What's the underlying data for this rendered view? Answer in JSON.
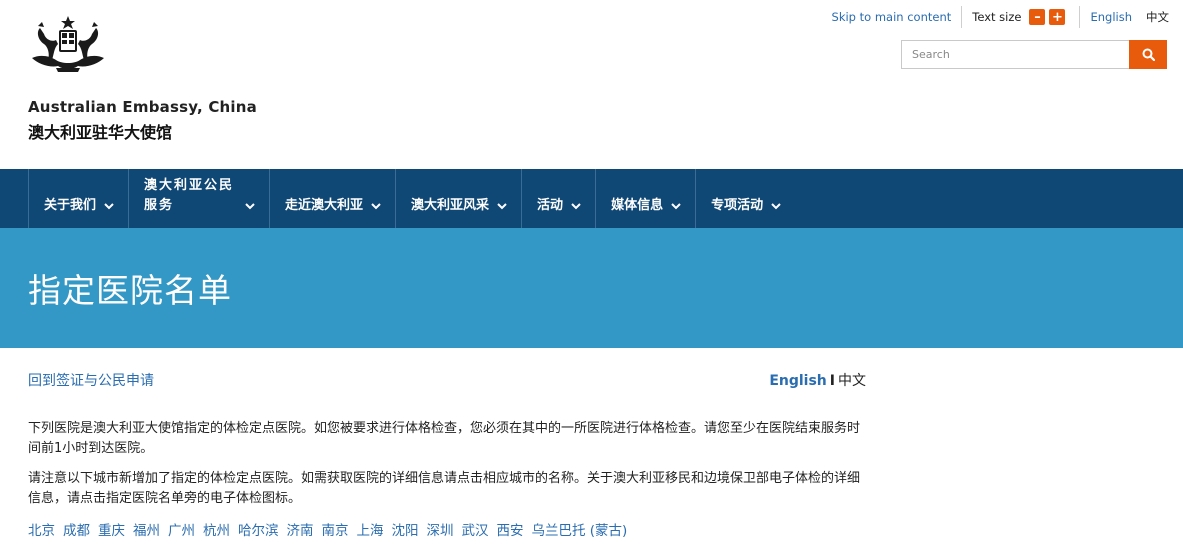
{
  "header": {
    "org_name_en": "Australian Embassy, China",
    "org_name_zh": "澳大利亚驻华大使馆"
  },
  "utility": {
    "skip_link": "Skip to main content",
    "text_size_label": "Text size",
    "decrease_symbol": "–",
    "increase_symbol": "+",
    "lang_en": "English",
    "lang_zh": "中文"
  },
  "search": {
    "placeholder": "Search",
    "value": ""
  },
  "nav": {
    "items": [
      {
        "label": "关于我们"
      },
      {
        "label": "澳大利亚公民服务"
      },
      {
        "label": "走近澳大利亚"
      },
      {
        "label": "澳大利亚风采"
      },
      {
        "label": "活动"
      },
      {
        "label": "媒体信息"
      },
      {
        "label": "专项活动"
      }
    ]
  },
  "banner": {
    "title": "指定医院名单"
  },
  "content": {
    "back_link": "回到签证与公民申请",
    "lang_switch_en": "English",
    "lang_switch_sep": "I",
    "lang_switch_zh": "中文",
    "paragraph_1": "下列医院是澳大利亚大使馆指定的体检定点医院。如您被要求进行体格检查，您必须在其中的一所医院进行体格检查。请您至少在医院结束服务时间前1小时到达医院。",
    "paragraph_2": "请注意以下城市新增加了指定的体检定点医院。如需获取医院的详细信息请点击相应城市的名称。关于澳大利亚移民和边境保卫部电子体检的详细信息，请点击指定医院名单旁的电子体检图标。",
    "cities": [
      "北京",
      "成都",
      "重庆",
      "福州",
      "广州",
      "杭州",
      "哈尔滨",
      "济南",
      "南京",
      "上海",
      "沈阳",
      "深圳",
      "武汉",
      "西安",
      "乌兰巴托 (蒙古)"
    ]
  },
  "colors": {
    "accent_orange": "#e85a0c",
    "nav_blue": "#0f4775",
    "banner_blue": "#3398c5",
    "link_blue": "#2a6db0"
  }
}
